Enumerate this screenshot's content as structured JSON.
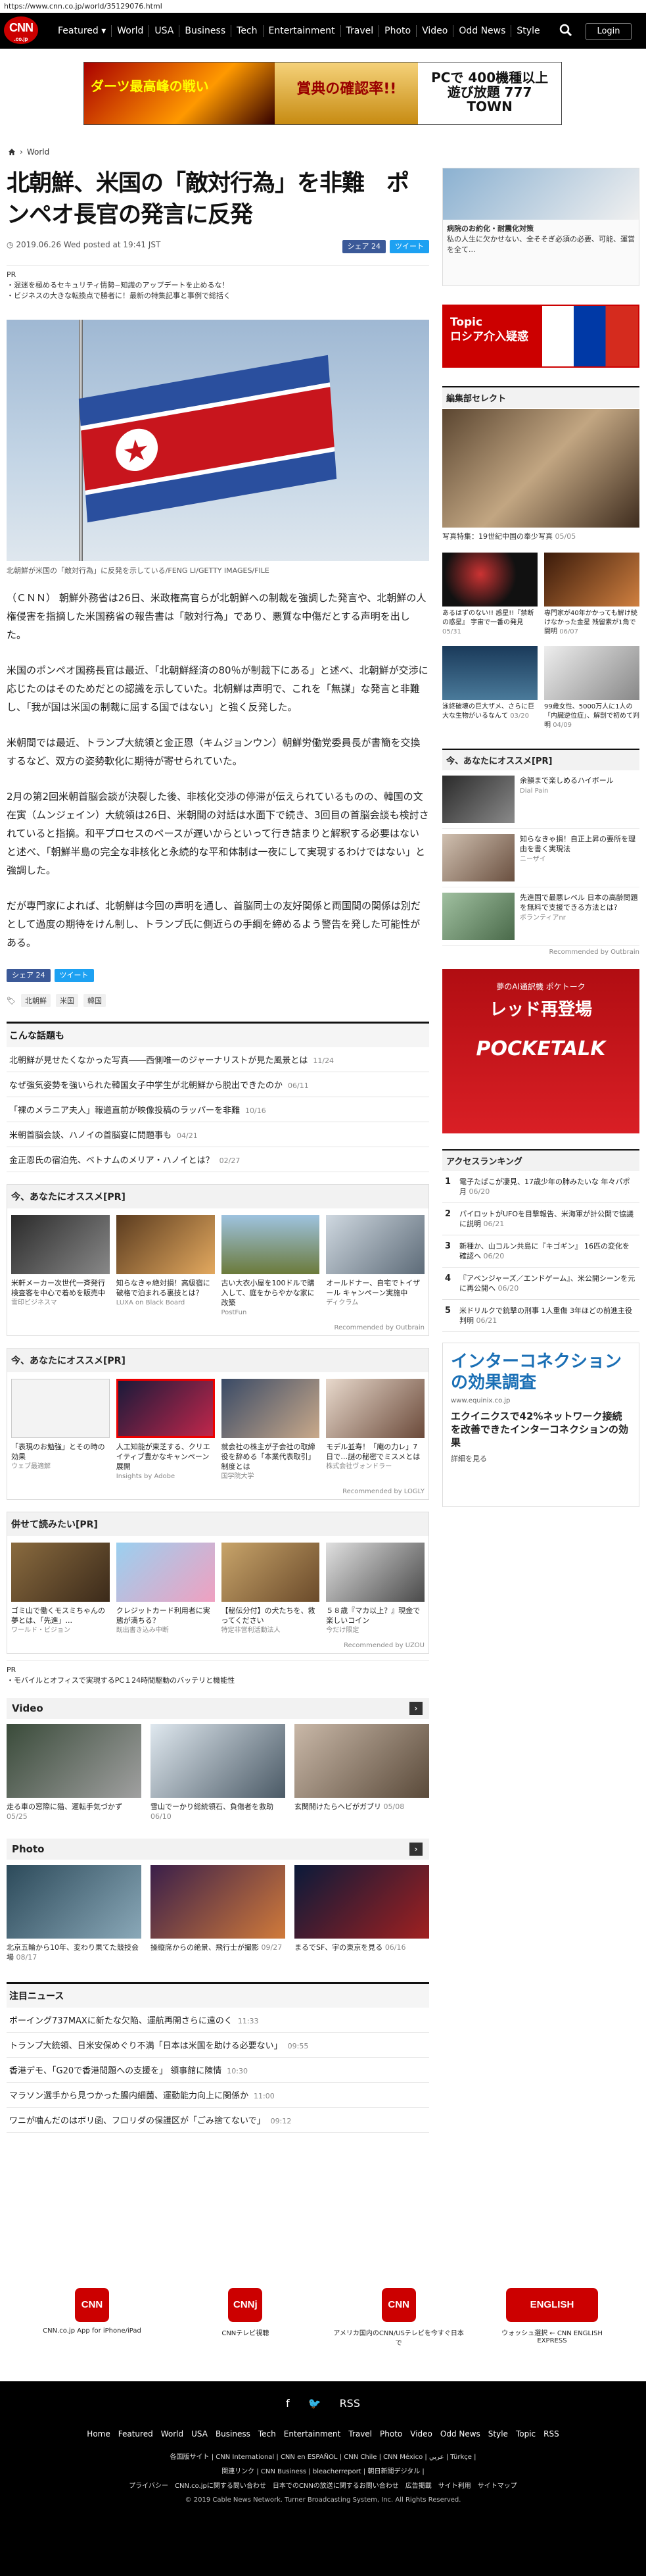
{
  "url": "https://www.cnn.co.jp/world/35129076.html",
  "nav": {
    "logo": "CNN",
    "logo_sub": ".co.jp",
    "items": [
      "Featured ▾",
      "World",
      "USA",
      "Business",
      "Tech",
      "Entertainment",
      "Travel",
      "Photo",
      "Video",
      "Odd News",
      "Style"
    ],
    "login": "Login"
  },
  "banner": {
    "left": "ダーツ最高峰の戦い",
    "mid": "賞典の確認率!!",
    "right": "PCで 400機種以上 遊び放題 777 TOWN"
  },
  "breadcrumb": "World",
  "article": {
    "headline": "北朝鮮、米国の「敵対行為」を非難　ポンペオ長官の発言に反発",
    "date": "2019.06.26 Wed posted at 19:41 JST",
    "share_fb": "シェア 24",
    "share_tw": "ツイート",
    "pr_label": "PR",
    "pr_lines": [
      "・混迷を極めるセキュリティ情勢−知識のアップデートを止めるな！",
      "・ビジネスの大きな転換点で勝者に！最新の特集記事と事例で総括く"
    ],
    "caption": "北朝鮮が米国の「敵対行為」に反発を示している/FENG LI/GETTY IMAGES/FILE",
    "paragraphs": [
      "（ＣＮＮ） 朝鮮外務省は26日、米政権高官らが北朝鮮への制裁を強調した発言や、北朝鮮の人権侵害を指摘した米国務省の報告書は「敵対行為」であり、悪質な中傷だとする声明を出した。",
      "米国のポンペオ国務長官は最近、「北朝鮮経済の80％が制裁下にある」と述べ、北朝鮮が交渉に応じたのはそのためだとの認識を示していた。北朝鮮は声明で、これを「無謀」な発言と非難し、「我が国は米国の制裁に屈する国ではない」と強く反発した。",
      "米朝間では最近、トランプ大統領と金正恩（キムジョンウン）朝鮮労働党委員長が書簡を交換するなど、双方の姿勢軟化に期待が寄せられていた。",
      "2月の第2回米朝首脳会談が決裂した後、非核化交渉の停滞が伝えられているものの、韓国の文在寅（ムンジェイン）大統領は26日、米朝間の対話は水面下で続き、3回目の首脳会談も検討されていると指摘。和平プロセスのペースが遅いからといって行き詰まりと解釈する必要はないと述べ、「朝鮮半島の完全な非核化と永続的な平和体制は一夜にして実現するわけではない」と強調した。",
      "だが専門家によれば、北朝鮮は今回の声明を通し、首脳同士の友好関係と両国間の関係は別だとして過度の期待をけん制し、トランプ氏に側近らの手綱を締めるよう警告を発した可能性がある。"
    ],
    "tags": [
      "北朝鮮",
      "米国",
      "韓国"
    ]
  },
  "related": {
    "title": "こんな話題も",
    "items": [
      {
        "text": "北朝鮮が見せたくなかった写真――西側唯一のジャーナリストが見た風景とは",
        "date": "11/24"
      },
      {
        "text": "なぜ強気姿勢を強いられた韓国女子中学生が北朝鮮から脱出できたのか",
        "date": "06/11"
      },
      {
        "text": "「裸のメラニア夫人」報道直前が映像投稿のラッパーを非難",
        "date": "10/16"
      },
      {
        "text": "米朝首脳会談、ハノイの首脳宴に問題事も",
        "date": "04/21"
      },
      {
        "text": "金正恩氏の宿泊先、ベトナムのメリア・ハノイとは？",
        "date": "02/27"
      }
    ]
  },
  "rec1": {
    "title": "今、あなたにオススメ[PR]",
    "items": [
      {
        "text": "米軒メーカー次世代一斉発行検査客を中心で着めを販売中",
        "src": "雪印ビジネスマ"
      },
      {
        "text": "知らなきゃ絶対損！高級宿に破格で泊まれる裏技とは？",
        "src": "LUXA on Black Board"
      },
      {
        "text": "古い大衣小屋を100ドルで購入して、庭をからやかな家に改築",
        "src": "PostFun"
      },
      {
        "text": "オールドナー、自宅でトイザール キャンペーン実施中",
        "src": "ディクラム"
      }
    ],
    "foot": "Recommended by Outbrain"
  },
  "rec2": {
    "title": "今、あなたにオススメ[PR]",
    "items": [
      {
        "text": "「表現のお勉強」とその時の効果",
        "src": "ウェブ最適解"
      },
      {
        "text": "人工知能が東芝する、クリエイティブ豊かなキャンペーン展開",
        "src": "Insights by Adobe"
      },
      {
        "text": "就会社の株主が子会社の取締役を辞める「本業代表取引」制度とは",
        "src": "国学院大学"
      },
      {
        "text": "モデル並寿！「庵の力レ」7日で…謎の秘密でミスメとは",
        "src": "株式会社ヴォンドラー"
      }
    ],
    "foot": "Recommended by LOGLY"
  },
  "rec3": {
    "title": "併せて読みたい[PR]",
    "items": [
      {
        "text": "ゴミ山で働くモスミちゃんの夢とは、「先進」...",
        "src": "ワールド・ビジョン"
      },
      {
        "text": "クレジットカード利用者に実態が満ちる？",
        "src": "既出書き込み中断"
      },
      {
        "text": "【秘伝分付】の犬たちを、救ってください",
        "src": "特定非営利活動法人"
      },
      {
        "text": "５８歳『マカ以上？』現金で楽しいコイン",
        "src": "今だけ限定"
      }
    ],
    "foot": "Recommended by UZOU",
    "pr": "PR",
    "pr_link": "・モバイルとオフィスで実現するPC１24時間駆動のバッテリと機能性"
  },
  "video": {
    "title": "Video",
    "items": [
      {
        "text": "走る車の窓際に猫、運転手気づかず",
        "date": "05/25"
      },
      {
        "text": "雪山でーかり総統領石、負傷者を救助",
        "date": "06/10"
      },
      {
        "text": "玄関開けたらヘビがガブリ",
        "date": "05/08"
      }
    ]
  },
  "photo": {
    "title": "Photo",
    "items": [
      {
        "text": "北京五輪から10年、変わり果てた競技会場",
        "date": "08/17"
      },
      {
        "text": "操縦席からの絶景、飛行士が撮影",
        "date": "09/27"
      },
      {
        "text": "まるでSF、宇の東京を見る",
        "date": "06/16"
      }
    ]
  },
  "attention": {
    "title": "注目ニュース",
    "items": [
      {
        "text": "ボーイング737MAXに新たな欠陥、運航再開さらに遠のく",
        "date": "11:33"
      },
      {
        "text": "トランプ大統領、日米安保めぐり不満「日本は米国を助ける必要ない」",
        "date": "09:55"
      },
      {
        "text": "香港デモ、「G20で香港問題への支援を」 領事館に陳情",
        "date": "10:30"
      },
      {
        "text": "マラソン選手から見つかった腸内細菌、運動能力向上に関係か",
        "date": "11:00"
      },
      {
        "text": "ワニが噛んだのはボリ函、フロリダの保護区が「ごみ捨てないで」",
        "date": "09:12"
      }
    ]
  },
  "sidebar": {
    "ad1_title": "病院のお約化・耐震化対策",
    "ad1_text": "私の人生に欠かせない、全そそぎ必須の必要、可能、運営を全て...",
    "topic_label": "Topic",
    "topic_text": "ロシア介入疑惑",
    "editor_title": "編集部セレクト",
    "editor_caption": "写真特集：19世紀中国の奉少写真",
    "editor_date": "05/05",
    "grid": [
      {
        "text": "あるはずのない!! 惑星!!『禁断の惑星』 宇宙で一番の発見",
        "date": "05/31"
      },
      {
        "text": "専門家が40年かかっても解け続けなかった金星 残留素が1角で開明",
        "date": "06/07"
      },
      {
        "text": "泳終破壊の巨大ザメ、さらに巨大な生物がいるなんて",
        "date": "03/20"
      },
      {
        "text": "99歳女性、5000万人に1人の「内臓逆位症」、解剖で初めて判明",
        "date": "04/09"
      }
    ],
    "rec_title": "今、あなたにオススメ[PR]",
    "rec": [
      {
        "text": "余韻まで楽しめるハイボール",
        "src": "Dial Pain"
      },
      {
        "text": "知らなきゃ損！自正上昇の要所を理由を書く実現法",
        "src": "ニーザイ"
      },
      {
        "text": "先進国で最悪レベル 日本の高齢問題を無料で支援できる方法とは?",
        "src": "ボランティアnr"
      }
    ],
    "rec_foot": "Recommended by Outbrain",
    "ad2_top": "夢のAI通訳機 ポケトーク",
    "ad2_mid": "レッド再登場",
    "ad2_logo": "POCKETALK",
    "rank_title": "アクセスランキング",
    "rank": [
      {
        "text": "電子たばこが凄見、17歳少年の肺みたいな 年々パポ月",
        "date": "06/20"
      },
      {
        "text": "パイロットがUFOを目撃報告、米海軍が計公開で協議に説明",
        "date": "06/21"
      },
      {
        "text": "新種か、山コルン共島に『キゴギン』 16匹の変化を確認へ",
        "date": "06/20"
      },
      {
        "text": "『アベンジャーズ／エンドゲーム』、米公開シーンを元に再公開へ",
        "date": "06/20"
      },
      {
        "text": "米ドリルクで銃撃の刑事 1人重傷 3年ほどの前進主役判明",
        "date": "06/21"
      }
    ],
    "ad3_head": "インターコネクションの効果調査",
    "ad3_url": "www.equinix.co.jp",
    "ad3_title": "エクイニクスで42%ネットワーク接続を改善できたインターコネクションの効果",
    "ad3_sub": "詳細を見る"
  },
  "apps": [
    {
      "icon": "CNN",
      "label": "CNN.co.jp App for iPhone/iPad"
    },
    {
      "icon": "CNNj",
      "label": "CNNテレビ視聴"
    },
    {
      "icon": "CNN US",
      "label": "アメリカ国内のCNN/USテレビを今すぐ日本で"
    },
    {
      "icon": "ENGLISH",
      "label": "ウォッシュ選択 ← CNN ENGLISH EXPRESS"
    }
  ],
  "footer": {
    "social": [
      "f",
      "🐦",
      "RSS"
    ],
    "links": [
      "Home",
      "Featured",
      "World",
      "USA",
      "Business",
      "Tech",
      "Entertainment",
      "Travel",
      "Photo",
      "Video",
      "Odd News",
      "Style",
      "Topic",
      "RSS"
    ],
    "line1": "各国版サイト | CNN International | CNN en ESPAÑOL | CNN Chile | CNN México | عربي | Türkçe |",
    "line2": "関連リンク | CNN Business | bleacherreport | 朝日新聞デジタル |",
    "line3": "プライバシー　CNN.co.jpに関する問い合わせ　日本でのCNNの放送に関するお問い合わせ　広告掲載　サイト利用　サイトマップ",
    "copy": "© 2019 Cable News Network. Turner Broadcasting System, Inc. All Rights Reserved."
  }
}
